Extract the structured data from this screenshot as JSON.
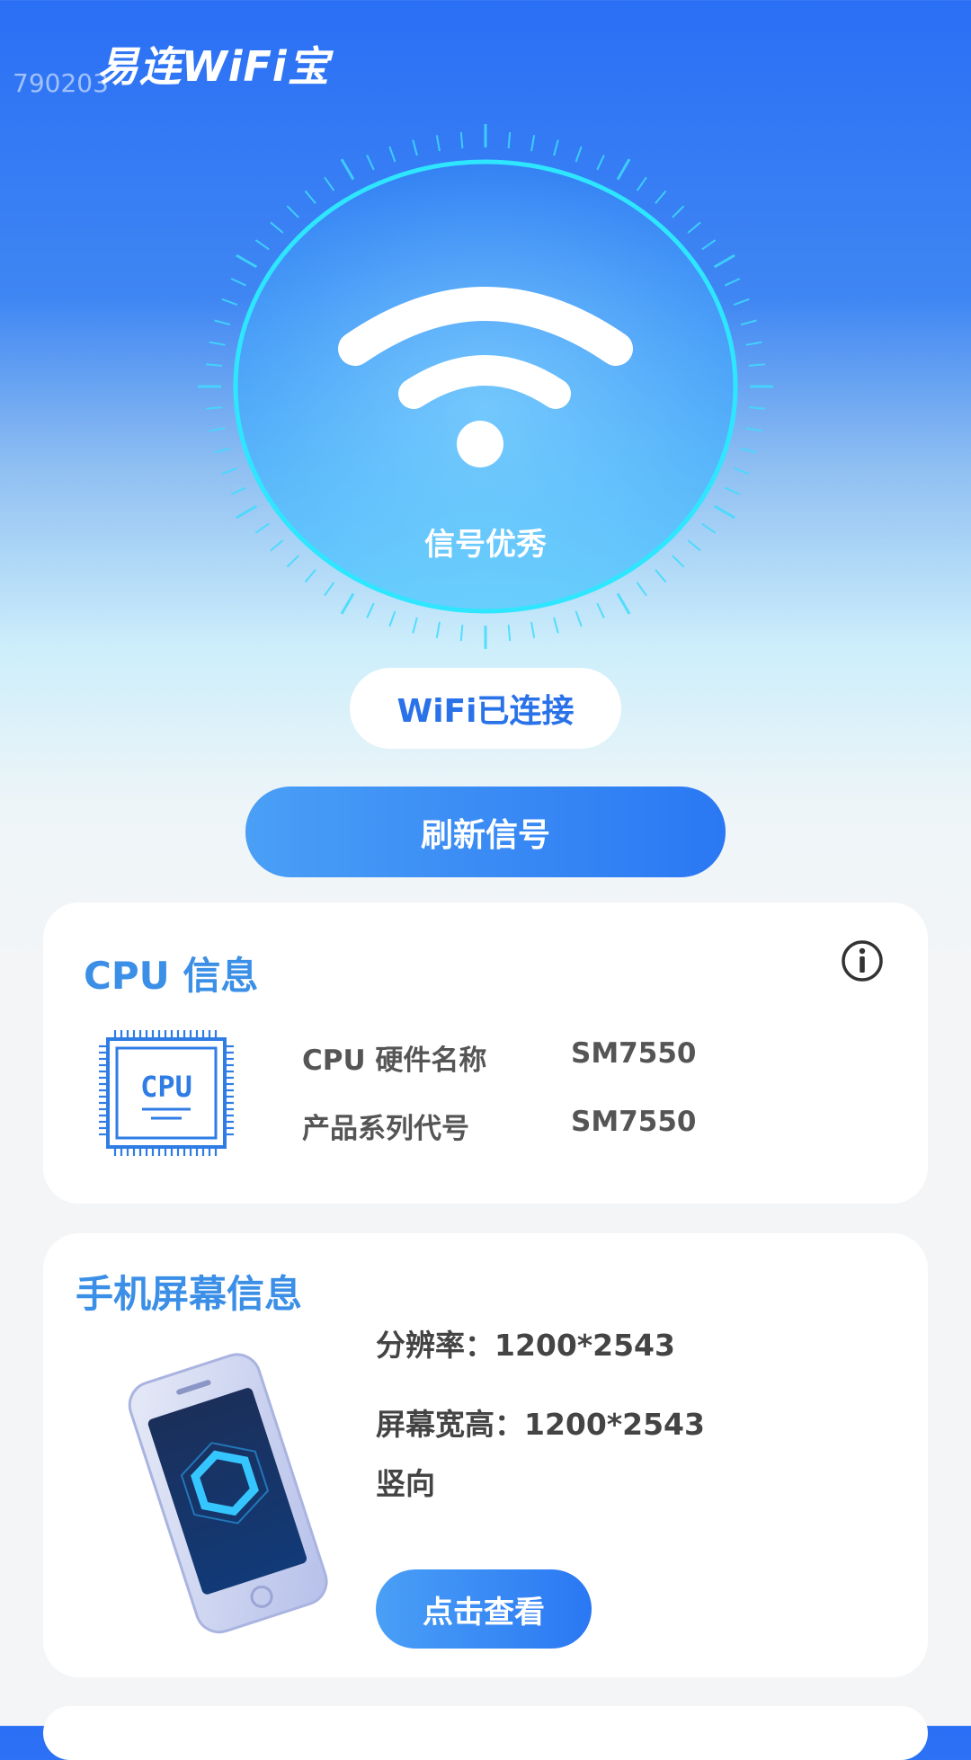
{
  "header": {
    "app_title": "易连WiFi宝",
    "build_tag": "790203"
  },
  "signal": {
    "label": "信号优秀"
  },
  "status": {
    "label": "WiFi已连接"
  },
  "actions": {
    "refresh_label": "刷新信号"
  },
  "cpu": {
    "title": "CPU 信息",
    "chip_text": "CPU",
    "rows": [
      {
        "label": "CPU 硬件名称",
        "value": "SM7550"
      },
      {
        "label": "产品系列代号",
        "value": "SM7550"
      }
    ]
  },
  "screen": {
    "title": "手机屏幕信息",
    "resolution": "分辨率：1200*2543",
    "size": "屏幕宽高：1200*2543",
    "orientation": "竖向",
    "view_label": "点击查看"
  },
  "colors": {
    "accent": "#3b8fe6",
    "button": "#2a78f3",
    "ring": "#2ee6ff"
  }
}
